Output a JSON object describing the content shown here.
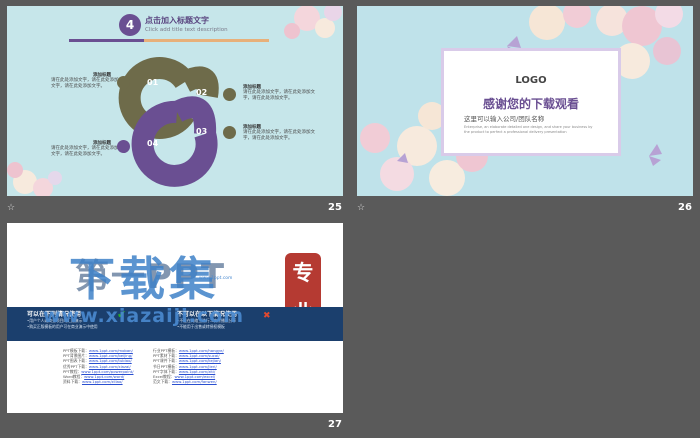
{
  "slides": [
    {
      "number": "25",
      "num_badge": "4",
      "title": "点击加入标题文字",
      "subtitle": "Click add title text description",
      "steps": [
        "01",
        "02",
        "03",
        "04"
      ],
      "blocks": [
        {
          "title": "添加标题",
          "text": "请在此处添加文字，请在此处添加文字，请在此处添加文字。"
        },
        {
          "title": "添加标题",
          "text": "请在此处添加文字，请在此处添加文字，请在此处添加文字。"
        },
        {
          "title": "添加标题",
          "text": "请在此处添加文字，请在此处添加文字，请在此处添加文字。"
        },
        {
          "title": "添加标题",
          "text": "请在此处添加文字，请在此处添加文字，请在此处添加文字。"
        }
      ],
      "colors": {
        "purple": "#6a4f92",
        "olive": "#6e6b4a",
        "bg": "#c6e6ea"
      }
    },
    {
      "number": "26",
      "logo": "LOGO",
      "thanks": "感谢您的下载观看",
      "company": "这里可以输入公司/团队名称",
      "desc": "Enterprise, an elaborate detailed one design, and share your business by the product to perfect a professional delivery presentation"
    },
    {
      "number": "27",
      "brand": "下载集",
      "brand_under": "第一PPT",
      "url": "www.xiazaiji.com",
      "url_small": "www.1ppt.com",
      "seal": "专业",
      "can_use_title": "可以在下列情况使用",
      "can_use_text": [
        "•用户个人或商业项目的汇报演示",
        "•购买正版模板的用户可在商业演示中使用"
      ],
      "cannot_use_title": "不可以在以下情况使用",
      "cannot_use_text": [
        "•不能在网络上进行二次传播或分享",
        "•不能用于出售或转授权模板"
      ],
      "links_left": [
        {
          "label": "PPT模板下载：",
          "url": "www.1ppt.com/moban/"
        },
        {
          "label": "PPT背景图片：",
          "url": "www.1ppt.com/beijing/"
        },
        {
          "label": "PPT图表下载：",
          "url": "www.1ppt.com/tubiao/"
        },
        {
          "label": "优秀PPT下载：",
          "url": "www.1ppt.com/xiazai/"
        },
        {
          "label": "PPT教程：",
          "url": "www.1ppt.com/powerpoint/"
        },
        {
          "label": "Word教程：",
          "url": "www.1ppt.com/word/"
        },
        {
          "label": "资料下载：",
          "url": "www.1ppt.com/ziliao/"
        }
      ],
      "links_right": [
        {
          "label": "行业PPT模板：",
          "url": "www.1ppt.com/hangye/"
        },
        {
          "label": "PPT素材下载：",
          "url": "www.1ppt.com/sucai/"
        },
        {
          "label": "PPT课件下载：",
          "url": "www.1ppt.com/kejian/"
        },
        {
          "label": "节日PPT模板：",
          "url": "www.1ppt.com/jieri/"
        },
        {
          "label": "PPT字体下载：",
          "url": "www.1ppt.com/ziti/"
        },
        {
          "label": "Excel教程：",
          "url": "www.1ppt.com/excel/"
        },
        {
          "label": "范文下载：",
          "url": "www.1ppt.com/fanwen/"
        }
      ]
    }
  ]
}
